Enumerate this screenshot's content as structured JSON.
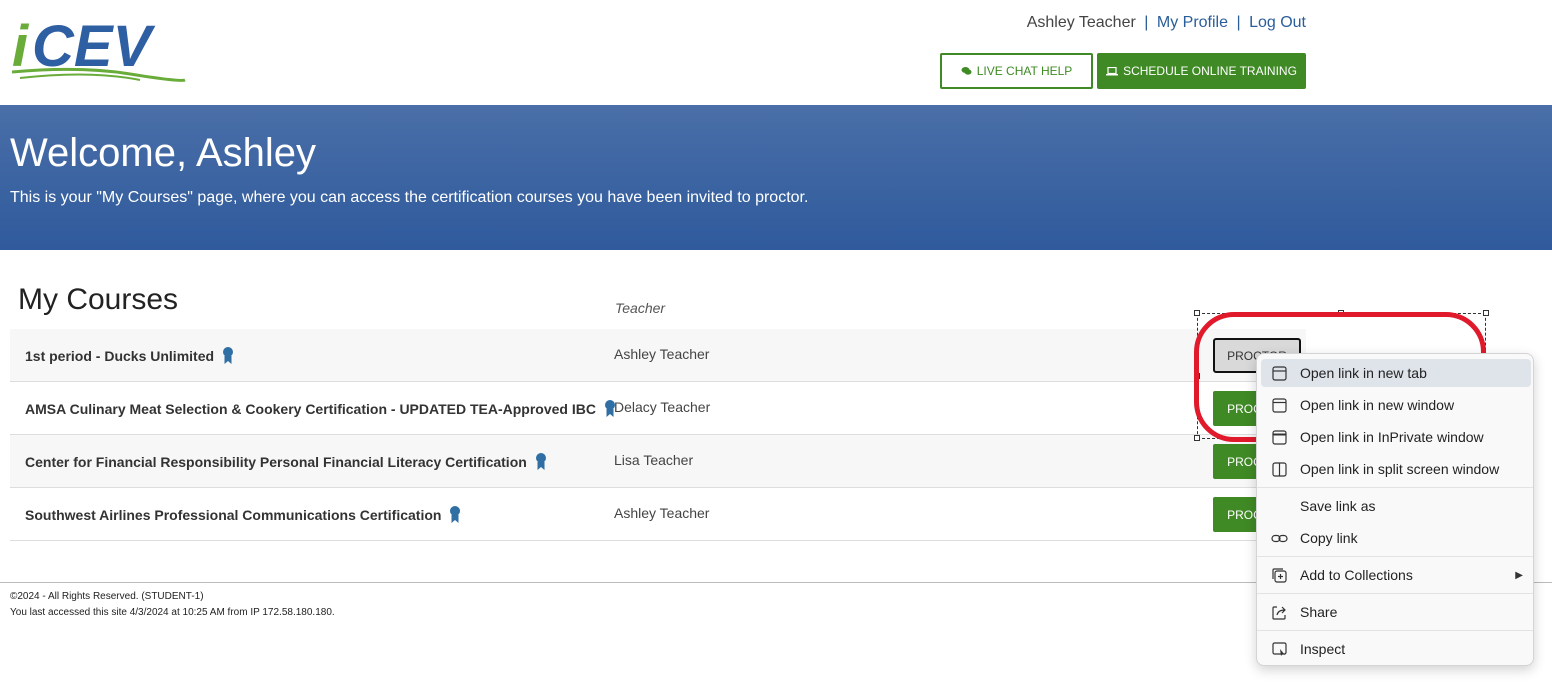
{
  "header": {
    "logo_text": "iCEV",
    "user_name": "Ashley Teacher",
    "separator": "|",
    "my_profile": "My Profile",
    "log_out": "Log Out",
    "live_chat_label": "LIVE CHAT HELP",
    "schedule_label": "SCHEDULE ONLINE TRAINING"
  },
  "banner": {
    "title": "Welcome, Ashley",
    "subtitle": "This is your \"My Courses\" page, where you can access the certification courses you have been invited to proctor."
  },
  "courses": {
    "title": "My Courses",
    "teacher_header": "Teacher",
    "rows": [
      {
        "name": "1st period - Ducks Unlimited",
        "teacher": "Ashley Teacher",
        "button": "PROCTOR"
      },
      {
        "name": "AMSA Culinary Meat Selection & Cookery Certification - UPDATED TEA-Approved IBC",
        "teacher": "Delacy Teacher",
        "button": "PROCTOR"
      },
      {
        "name": "Center for Financial Responsibility Personal Financial Literacy Certification",
        "teacher": "Lisa Teacher",
        "button": "PROCTOR"
      },
      {
        "name": "Southwest Airlines Professional Communications Certification",
        "teacher": "Ashley Teacher",
        "button": "PROCTOR"
      }
    ]
  },
  "footer": {
    "copyright": "©2024 - All Rights Reserved. (STUDENT-1)",
    "last_access": "You last accessed this site 4/3/2024 at 10:25 AM from IP 172.58.180.180."
  },
  "context_menu": {
    "items": [
      {
        "label": "Open link in new tab",
        "icon": "new-tab-icon"
      },
      {
        "label": "Open link in new window",
        "icon": "new-window-icon"
      },
      {
        "label": "Open link in InPrivate window",
        "icon": "inprivate-icon"
      },
      {
        "label": "Open link in split screen window",
        "icon": "split-screen-icon"
      },
      {
        "label": "Save link as",
        "icon": ""
      },
      {
        "label": "Copy link",
        "icon": "link-icon"
      },
      {
        "label": "Add to Collections",
        "icon": "collections-icon"
      },
      {
        "label": "Share",
        "icon": "share-icon"
      },
      {
        "label": "Inspect",
        "icon": "inspect-icon"
      }
    ]
  },
  "colors": {
    "brand_green": "#3f8a25",
    "brand_blue": "#2f5a9c",
    "link_blue": "#2a5e9a",
    "annotation_red": "#e0192b"
  }
}
